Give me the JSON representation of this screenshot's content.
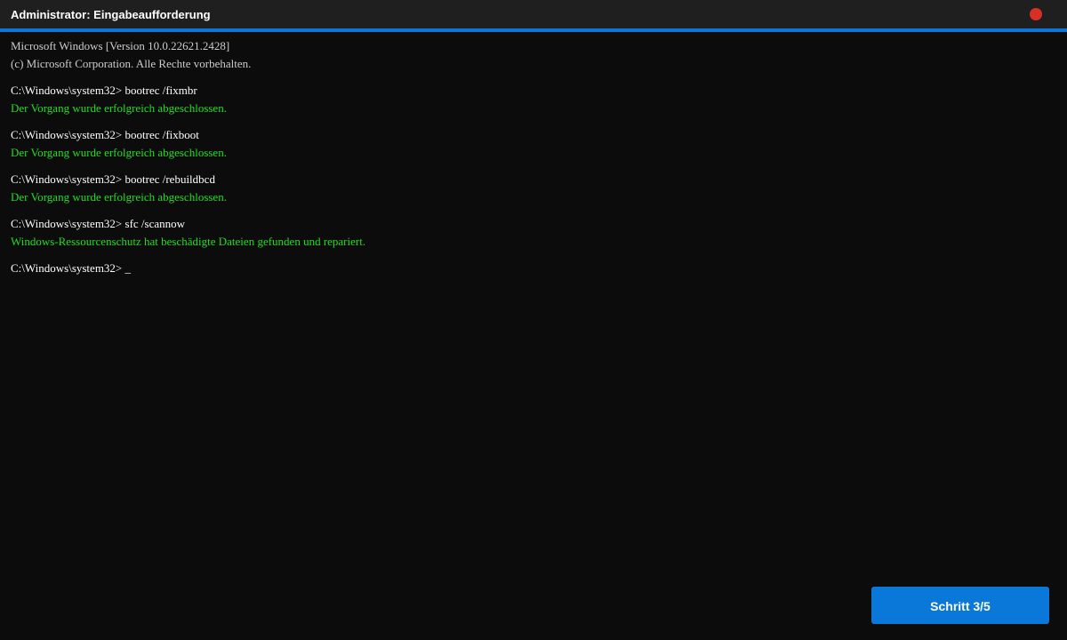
{
  "window": {
    "title": "Administrator: Eingabeaufforderung",
    "accent_color": "#0a78d8",
    "close_color": "#d93025",
    "close_icon": "close-dot-icon"
  },
  "console": {
    "header_line1": "Microsoft Windows [Version 10.0.22621.2428]",
    "header_line2": "(c) Microsoft Corporation. Alle Rechte vorbehalten.",
    "entries": [
      {
        "command": "C:\\Windows\\system32> bootrec /fixmbr",
        "output": "Der Vorgang wurde erfolgreich abgeschlossen."
      },
      {
        "command": "C:\\Windows\\system32> bootrec /fixboot",
        "output": "Der Vorgang wurde erfolgreich abgeschlossen."
      },
      {
        "command": "C:\\Windows\\system32> bootrec /rebuildbcd",
        "output": "Der Vorgang wurde erfolgreich abgeschlossen."
      },
      {
        "command": "C:\\Windows\\system32> sfc /scannow",
        "output": "Windows-Ressourcenschutz hat beschädigte Dateien gefunden und repariert."
      }
    ],
    "prompt": "C:\\Windows\\system32> _",
    "output_color": "#22dd22"
  },
  "footer": {
    "step_button_label": "Schritt 3/5"
  }
}
